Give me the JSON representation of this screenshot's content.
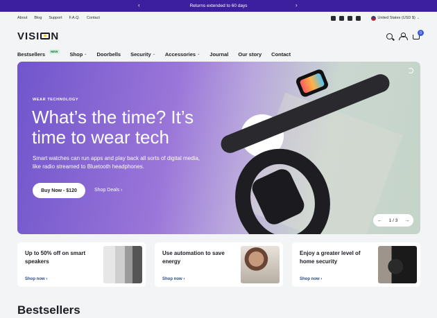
{
  "announcement": {
    "text": "Returns extended to 60 days",
    "prev": "‹",
    "next": "›"
  },
  "utility": {
    "links": [
      "About",
      "Blog",
      "Support",
      "F.A.Q.",
      "Contact"
    ],
    "currency": "United States (USD $)"
  },
  "header": {
    "logo": "VISION",
    "cart_count": "0"
  },
  "nav": {
    "items": [
      {
        "label": "Bestsellers",
        "badge": "NEW"
      },
      {
        "label": "Shop"
      },
      {
        "label": "Doorbells"
      },
      {
        "label": "Security"
      },
      {
        "label": "Accessories"
      },
      {
        "label": "Journal"
      },
      {
        "label": "Our story"
      },
      {
        "label": "Contact"
      }
    ]
  },
  "hero": {
    "eyebrow": "WEAR TECHNOLOGY",
    "title": "What’s the time? It’s time to wear tech",
    "description": "Smart watches can run apps and play back all sorts of digital media, like radio streamed to Bluetooth headphones.",
    "primary_button": "Buy Now - $120",
    "secondary_link": "Shop Deals ›",
    "pager": "1 / 3"
  },
  "cards": [
    {
      "title": "Up to 50% off on smart speakers",
      "link": "Shop now ›"
    },
    {
      "title": "Use automation to save energy",
      "link": "Shop now ›"
    },
    {
      "title": "Enjoy a greater level of home security",
      "link": "Shop now ›"
    }
  ],
  "section": {
    "title": "Bestsellers"
  }
}
